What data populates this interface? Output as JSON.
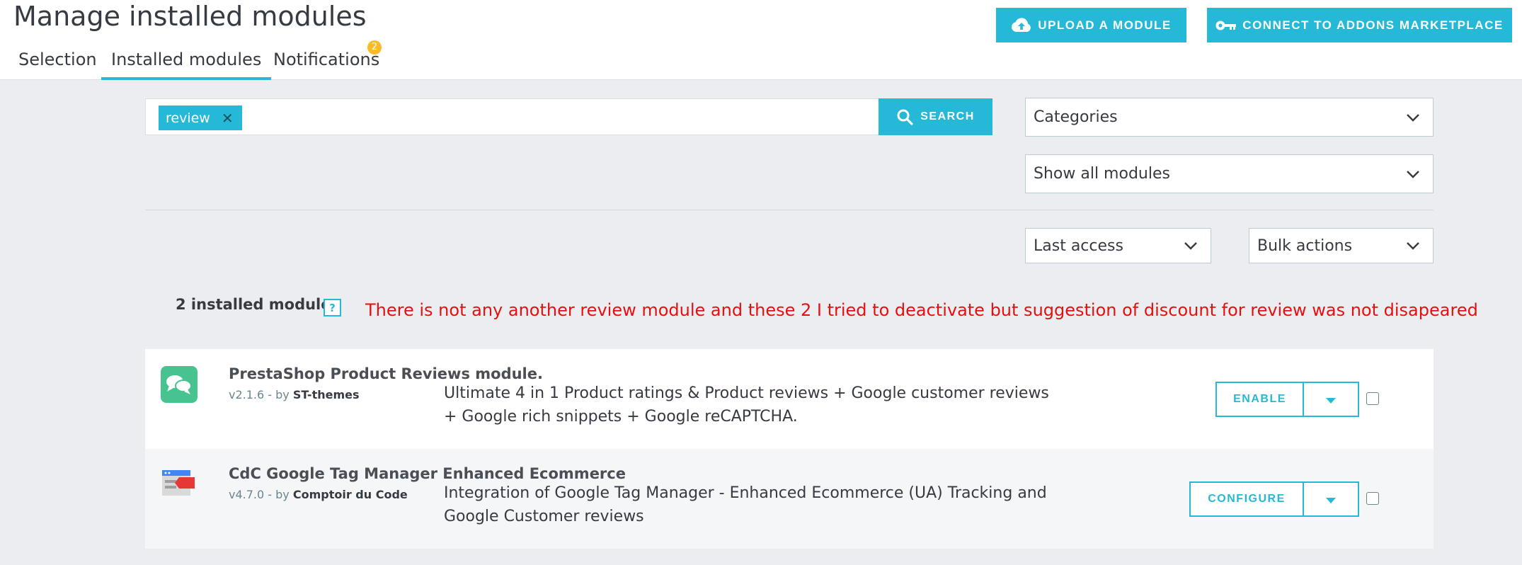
{
  "header": {
    "title": "Manage installed modules",
    "tabs": [
      {
        "label": "Selection"
      },
      {
        "label": "Installed modules"
      },
      {
        "label": "Notifications"
      }
    ],
    "notifications_badge": "2",
    "upload_button": "UPLOAD A MODULE",
    "connect_button": "CONNECT TO ADDONS MARKETPLACE"
  },
  "search": {
    "tag": "review",
    "button": "SEARCH"
  },
  "filters": {
    "categories": "Categories",
    "status": "Show all modules",
    "sort": "Last access",
    "bulk": "Bulk actions"
  },
  "results": {
    "count": "2 installed modules",
    "help": "?",
    "annotation": "There is not any another review module and these 2 I tried to deactivate but suggestion of discount for review was not disapeared"
  },
  "modules": [
    {
      "name": "PrestaShop Product Reviews module.",
      "version": "v2.1.6 - by",
      "author": "ST-themes",
      "description": "Ultimate 4 in 1 Product ratings & Product reviews + Google customer reviews + Google rich snippets + Google reCAPTCHA.",
      "action": "ENABLE"
    },
    {
      "name": "CdC Google Tag Manager Enhanced Ecommerce",
      "version": "v4.7.0 - by",
      "author": "Comptoir du Code",
      "description": "Integration of Google Tag Manager - Enhanced Ecommerce (UA) Tracking and Google Customer reviews",
      "action": "CONFIGURE"
    }
  ],
  "colors": {
    "accent": "#25b9d7",
    "annotation": "#e51010",
    "badge": "#fbbb22"
  }
}
